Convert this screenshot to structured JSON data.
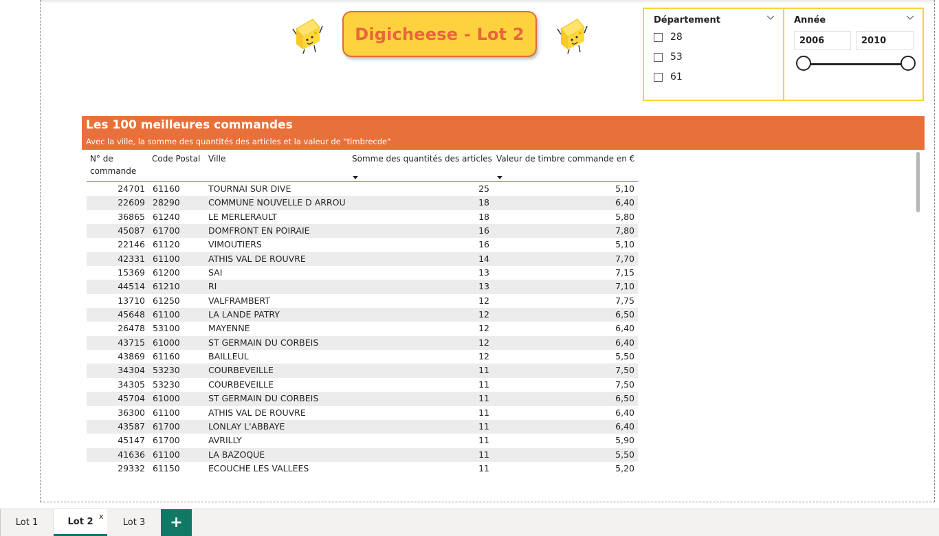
{
  "report": {
    "title": "Digicheese - Lot 2"
  },
  "slicers": {
    "departement": {
      "title": "Département",
      "options": [
        "28",
        "53",
        "61"
      ]
    },
    "annee": {
      "title": "Année",
      "start": "2006",
      "end": "2010",
      "range_fraction": [
        0,
        1
      ]
    }
  },
  "table_visual": {
    "title": "Les 100 meilleures commandes",
    "subtitle": "Avec la ville, la somme des quantités des articles et la valeur de \"timbrecde\"",
    "columns": [
      "N° de commande",
      "Code Postal",
      "Ville",
      "Somme des quantités des articles",
      "Valeur de timbre commande en €"
    ],
    "rows": [
      [
        "24701",
        "61160",
        "TOURNAI SUR DIVE",
        "25",
        "5,10"
      ],
      [
        "22609",
        "28290",
        "COMMUNE NOUVELLE D ARROU",
        "18",
        "6,40"
      ],
      [
        "36865",
        "61240",
        "LE MERLERAULT",
        "18",
        "5,80"
      ],
      [
        "45087",
        "61700",
        "DOMFRONT EN POIRAIE",
        "16",
        "7,80"
      ],
      [
        "22146",
        "61120",
        "VIMOUTIERS",
        "16",
        "5,10"
      ],
      [
        "42331",
        "61100",
        "ATHIS VAL DE ROUVRE",
        "14",
        "7,70"
      ],
      [
        "15369",
        "61200",
        "SAI",
        "13",
        "7,15"
      ],
      [
        "44514",
        "61210",
        "RI",
        "13",
        "7,10"
      ],
      [
        "13710",
        "61250",
        "VALFRAMBERT",
        "12",
        "7,75"
      ],
      [
        "45648",
        "61100",
        "LA LANDE PATRY",
        "12",
        "6,50"
      ],
      [
        "26478",
        "53100",
        "MAYENNE",
        "12",
        "6,40"
      ],
      [
        "43715",
        "61000",
        "ST GERMAIN DU CORBEIS",
        "12",
        "6,40"
      ],
      [
        "43869",
        "61160",
        "BAILLEUL",
        "12",
        "5,50"
      ],
      [
        "34304",
        "53230",
        "COURBEVEILLE",
        "11",
        "7,50"
      ],
      [
        "34305",
        "53230",
        "COURBEVEILLE",
        "11",
        "7,50"
      ],
      [
        "45704",
        "61000",
        "ST GERMAIN DU CORBEIS",
        "11",
        "6,50"
      ],
      [
        "36300",
        "61100",
        "ATHIS VAL DE ROUVRE",
        "11",
        "6,40"
      ],
      [
        "43587",
        "61700",
        "LONLAY L'ABBAYE",
        "11",
        "6,40"
      ],
      [
        "45147",
        "61700",
        "AVRILLY",
        "11",
        "5,90"
      ],
      [
        "41636",
        "61100",
        "LA BAZOQUE",
        "11",
        "5,50"
      ],
      [
        "29332",
        "61150",
        "ECOUCHE LES VALLEES",
        "11",
        "5,20"
      ]
    ]
  },
  "tabs": {
    "items": [
      "Lot 1",
      "Lot 2",
      "Lot 3"
    ],
    "active": "Lot 2",
    "close": "x",
    "add": "+"
  },
  "colors": {
    "title_bg": "#fdd23e",
    "title_text": "#e8663a",
    "visual_header": "#e8703a",
    "slicer_border": "#f6d33c",
    "tab_accent": "#117865"
  },
  "icons": [
    "cheese-mascot-icon",
    "chevron-down-icon",
    "plus-icon",
    "close-icon"
  ]
}
